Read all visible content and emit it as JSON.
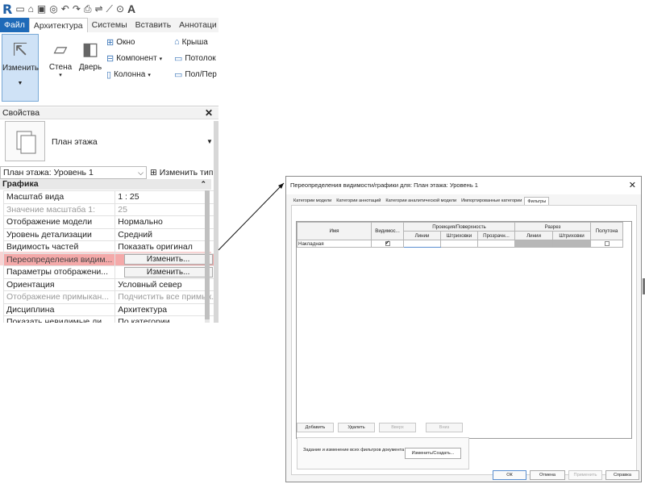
{
  "qat": {
    "logo": "R",
    "icons": [
      "new-icon",
      "open-icon",
      "save-icon",
      "sync-icon",
      "undo-icon",
      "redo-icon",
      "print-icon",
      "measure-icon",
      "dimension-icon",
      "tag-icon"
    ],
    "text_letter": "A"
  },
  "ribbon": {
    "tabs": [
      "Файл",
      "Архитектура",
      "Системы",
      "Вставить",
      "Аннотаци"
    ],
    "active_tab": "Архитектура",
    "modify": "Изменить",
    "wall": "Стена",
    "door": "Дверь",
    "window": "Окно",
    "component": "Компонент",
    "column": "Колонна",
    "roof": "Крыша",
    "ceiling": "Потолок",
    "floor": "Пол/Пер"
  },
  "properties": {
    "title": "Свойства",
    "type_name": "План этажа",
    "instance_selector": "План этажа: Уровень 1",
    "edit_type": "Изменить тип",
    "group": "Графика",
    "rows": [
      {
        "name": "Масштаб вида",
        "value": "1 : 25",
        "state": "normal"
      },
      {
        "name": "Значение масштаба    1:",
        "value": "25",
        "state": "dim"
      },
      {
        "name": "Отображение модели",
        "value": "Нормально",
        "state": "normal"
      },
      {
        "name": "Уровень детализации",
        "value": "Средний",
        "state": "normal"
      },
      {
        "name": "Видимость частей",
        "value": "Показать оригинал",
        "state": "normal"
      },
      {
        "name": "Переопределения видим...",
        "value": "Изменить...",
        "state": "hl"
      },
      {
        "name": "Параметры отображени...",
        "value": "Изменить...",
        "state": "btn"
      },
      {
        "name": "Ориентация",
        "value": "Условный север",
        "state": "normal"
      },
      {
        "name": "Отображение примыкан...",
        "value": "Подчистить все примык...",
        "state": "dim"
      },
      {
        "name": "Дисциплина",
        "value": "Архитектура",
        "state": "normal"
      },
      {
        "name": "Показать невидимые ли...",
        "value": "По категории",
        "state": "normal"
      }
    ]
  },
  "dialog": {
    "title": "Переопределения видимости/графики для: План этажа: Уровень 1",
    "tabs": [
      "Категории модели",
      "Категории аннотаций",
      "Категории аналитической модели",
      "Импортированные категории",
      "Фильтры"
    ],
    "active_tab": "Фильтры",
    "grid": {
      "h_name": "Имя",
      "h_visibility": "Видимос...",
      "h_projection": "Проекция/Поверхность",
      "h_cut": "Разрез",
      "h_halftone": "Полутона",
      "sub_lines": "Линии",
      "sub_patterns": "Штриховки",
      "sub_transparency": "Прозрачн...",
      "sub_cut_lines": "Линии",
      "sub_cut_patterns": "Штриховки",
      "rows": [
        {
          "name": "Накладная",
          "visible": true,
          "halftone": false
        }
      ]
    },
    "buttons": {
      "add": "Добавить",
      "delete": "Удалить",
      "up": "Вверх",
      "down": "Вниз"
    },
    "filters_text": "Задание и изменение всех фильтров документа",
    "filters_button": "Изменить/Создать...",
    "footer": {
      "ok": "ОК",
      "cancel": "Отмена",
      "apply": "Применить",
      "help": "Справка"
    }
  }
}
